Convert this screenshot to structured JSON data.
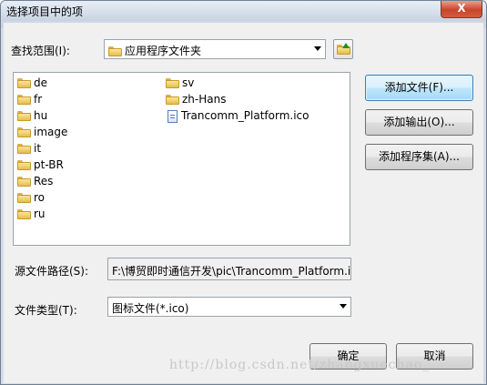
{
  "window": {
    "title": "选择项目中的项",
    "close_label": "X"
  },
  "lookin": {
    "label": "查找范围(I):",
    "value": "应用程序文件夹"
  },
  "files": {
    "col1": [
      "de",
      "fr",
      "hu",
      "image",
      "it",
      "pt-BR",
      "Res",
      "ro",
      "ru"
    ],
    "col2_folders": [
      "sv",
      "zh-Hans"
    ],
    "col2_file": "Trancomm_Platform.ico"
  },
  "buttons": {
    "add_file": "添加文件(F)...",
    "add_output": "添加输出(O)...",
    "add_assembly": "添加程序集(A)...",
    "ok": "确定",
    "cancel": "取消"
  },
  "source_path": {
    "label": "源文件路径(S):",
    "value": "F:\\博贸即时通信开发\\pic\\Trancomm_Platform.ic"
  },
  "file_type": {
    "label": "文件类型(T):",
    "value": "图标文件(*.ico)"
  },
  "watermark": "http://blog.csdn.net/zhangxuechao_"
}
